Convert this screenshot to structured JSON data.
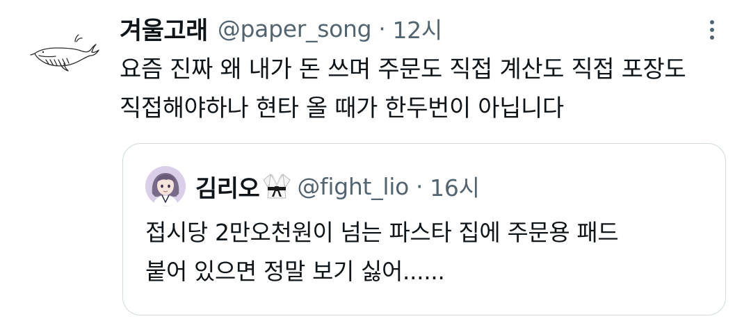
{
  "tweet": {
    "display_name": "겨울고래",
    "handle": "@paper_song",
    "separator": "·",
    "time": "12시",
    "avatar_icon": "whale-drawing-icon",
    "more_icon": "more-vertical-icon",
    "text_line1": "요즘 진짜 왜 내가 돈 쓰며 주문도 직접 계산도 직접 포장도",
    "text_line2": "직접해야하나 현타 올 때가 한두번이 아닙니다"
  },
  "quote": {
    "display_name": "김리오",
    "badge_icon": "martial-arts-uniform-emoji",
    "handle": "@fight_lio",
    "separator": "·",
    "time": "16시",
    "avatar_icon": "anime-avatar",
    "text_line1": "접시당 2만오천원이 넘는 파스타 집에 주문용 패드",
    "text_line2": "붙어 있으면 정말 보기 싫어......"
  },
  "colors": {
    "text_primary": "#0f1419",
    "text_secondary": "#536471",
    "border": "#cfd9de",
    "background": "#ffffff"
  }
}
